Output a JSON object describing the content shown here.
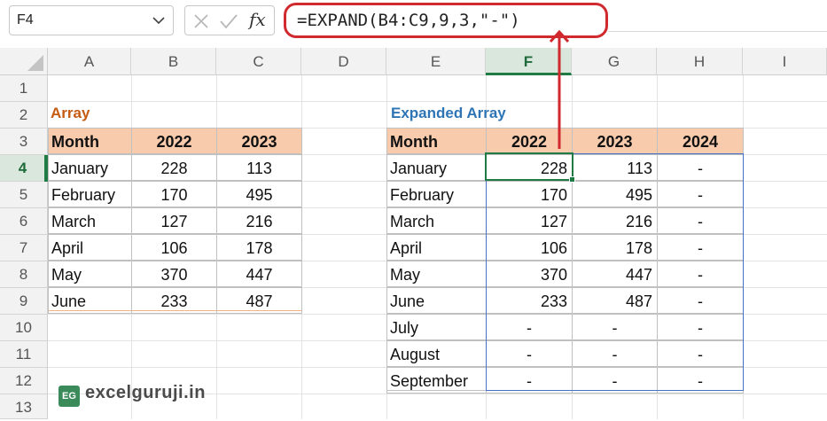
{
  "name_box": {
    "value": "F4"
  },
  "formula_bar": {
    "formula": "=EXPAND(B4:C9,9,3,\"-\")",
    "fx_label": "fx"
  },
  "columns": [
    "A",
    "B",
    "C",
    "D",
    "E",
    "F",
    "G",
    "H",
    "I"
  ],
  "rows": [
    "1",
    "2",
    "3",
    "4",
    "5",
    "6",
    "7",
    "8",
    "9",
    "10",
    "11",
    "12",
    "13"
  ],
  "source_table": {
    "title": "Array",
    "headers": [
      "Month",
      "2022",
      "2023"
    ],
    "rows": [
      [
        "January",
        "228",
        "113"
      ],
      [
        "February",
        "170",
        "495"
      ],
      [
        "March",
        "127",
        "216"
      ],
      [
        "April",
        "106",
        "178"
      ],
      [
        "May",
        "370",
        "447"
      ],
      [
        "June",
        "233",
        "487"
      ]
    ]
  },
  "expanded_table": {
    "title": "Expanded Array",
    "headers": [
      "Month",
      "2022",
      "2023",
      "2024"
    ],
    "rows": [
      [
        "January",
        "228",
        "113",
        "-"
      ],
      [
        "February",
        "170",
        "495",
        "-"
      ],
      [
        "March",
        "127",
        "216",
        "-"
      ],
      [
        "April",
        "106",
        "178",
        "-"
      ],
      [
        "May",
        "370",
        "447",
        "-"
      ],
      [
        "June",
        "233",
        "487",
        "-"
      ],
      [
        "July",
        "-",
        "-",
        "-"
      ],
      [
        "August",
        "-",
        "-",
        "-"
      ],
      [
        "September",
        "-",
        "-",
        "-"
      ]
    ]
  },
  "watermark": {
    "logo": "EG",
    "text": "excelguruji.in"
  },
  "colors": {
    "header_fill": "#f8cbad",
    "source_title": "#c55a11",
    "expanded_title": "#2e75b6",
    "annotation": "#d02a2f",
    "selection": "#1f7a44",
    "spill_border": "#4472c4"
  }
}
